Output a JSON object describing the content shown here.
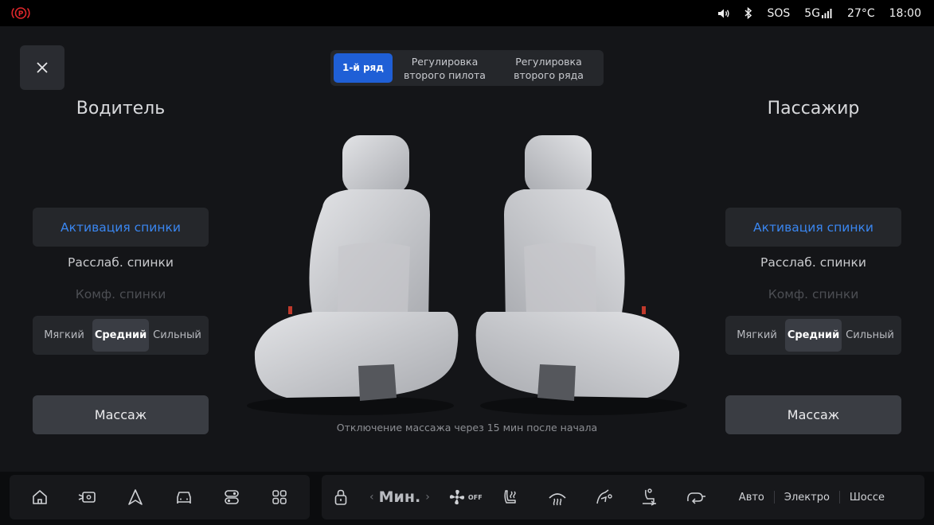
{
  "status": {
    "sos": "SOS",
    "network": "5G",
    "temperature": "27°C",
    "time": "18:00"
  },
  "tabs": [
    {
      "label": "1-й ряд",
      "active": true
    },
    {
      "label": "Регулировка второго пилота",
      "active": false
    },
    {
      "label": "Регулировка второго ряда",
      "active": false
    }
  ],
  "driver": {
    "title": "Водитель",
    "opt_active": "Активация спинки",
    "opt_relax": "Расслаб. спинки",
    "opt_comfort": "Комф. спинки",
    "levels": [
      "Мягкий",
      "Средний",
      "Сильный"
    ],
    "selected_level": "Средний",
    "massage": "Массаж"
  },
  "passenger": {
    "title": "Пассажир",
    "opt_active": "Активация спинки",
    "opt_relax": "Расслаб. спинки",
    "opt_comfort": "Комф. спинки",
    "levels": [
      "Мягкий",
      "Средний",
      "Сильный"
    ],
    "selected_level": "Средний",
    "massage": "Массаж"
  },
  "notice": "Отключение массажа через 15 мин после начала",
  "climate": {
    "fan_speed": "Мин.",
    "fan_off_tag": "OFF",
    "modes": [
      "Авто",
      "Электро",
      "Шоссе"
    ]
  },
  "colors": {
    "accent": "#1f5fd6",
    "active_text": "#3a86f0",
    "parking_icon": "#e0272b"
  }
}
